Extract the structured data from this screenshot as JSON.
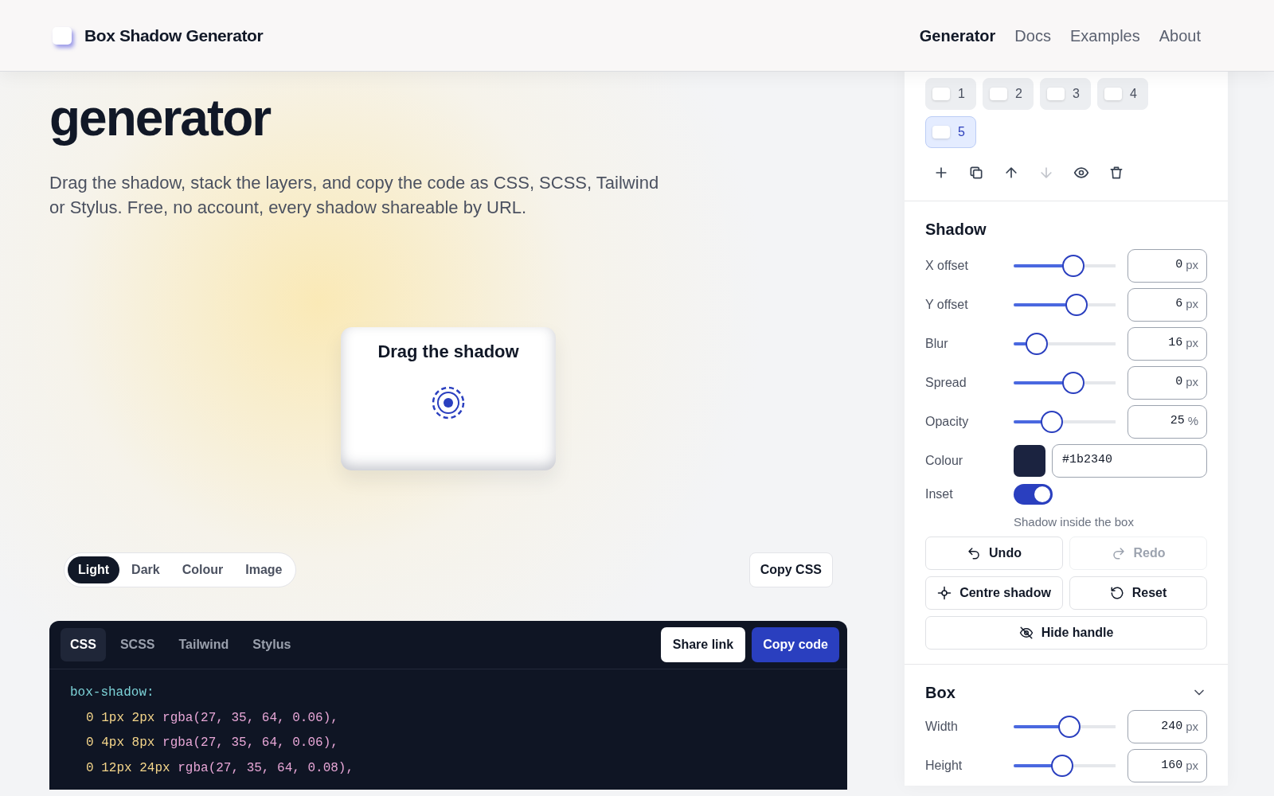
{
  "header": {
    "brand": "Box Shadow Generator",
    "nav": [
      {
        "label": "Generator",
        "selected": true
      },
      {
        "label": "Docs",
        "selected": false
      },
      {
        "label": "Examples",
        "selected": false
      },
      {
        "label": "About",
        "selected": false
      }
    ]
  },
  "hero": {
    "title": "generator",
    "description": "Drag the shadow, stack the layers, and copy the code as CSS, SCSS, Tailwind or Stylus. Free, no account, every shadow shareable by URL."
  },
  "preview": {
    "card_label": "Drag the shadow",
    "backgrounds": [
      {
        "label": "Light",
        "selected": true
      },
      {
        "label": "Dark",
        "selected": false
      },
      {
        "label": "Colour",
        "selected": false
      },
      {
        "label": "Image",
        "selected": false
      }
    ],
    "copy_button": "Copy CSS"
  },
  "code": {
    "tabs": [
      {
        "label": "CSS",
        "selected": true
      },
      {
        "label": "SCSS",
        "selected": false
      },
      {
        "label": "Tailwind",
        "selected": false
      },
      {
        "label": "Stylus",
        "selected": false
      }
    ],
    "share_button": "Share link",
    "copy_button": "Copy code",
    "lines": [
      {
        "indented": false,
        "tokens": [
          {
            "kind": "property",
            "text": "box-shadow:"
          }
        ]
      },
      {
        "indented": true,
        "tokens": [
          {
            "kind": "number",
            "text": "0 1px 2px"
          },
          {
            "kind": "function",
            "text": "rgba(27, 35, 64, 0.06),"
          }
        ]
      },
      {
        "indented": true,
        "tokens": [
          {
            "kind": "number",
            "text": "0 4px 8px"
          },
          {
            "kind": "function",
            "text": "rgba(27, 35, 64, 0.06),"
          }
        ]
      },
      {
        "indented": true,
        "tokens": [
          {
            "kind": "number",
            "text": "0 12px 24px"
          },
          {
            "kind": "function",
            "text": "rgba(27, 35, 64, 0.08),"
          }
        ]
      }
    ]
  },
  "panel": {
    "layers": [
      {
        "label": "1",
        "selected": false
      },
      {
        "label": "2",
        "selected": false
      },
      {
        "label": "3",
        "selected": false
      },
      {
        "label": "4",
        "selected": false
      },
      {
        "label": "5",
        "selected": true
      }
    ],
    "layer_actions": [
      {
        "kind": "add",
        "disabled": false
      },
      {
        "kind": "duplicate",
        "disabled": false
      },
      {
        "kind": "up",
        "disabled": false
      },
      {
        "kind": "down",
        "disabled": true
      },
      {
        "kind": "visibility",
        "disabled": false
      },
      {
        "kind": "delete",
        "disabled": false
      }
    ],
    "shadow": {
      "title": "Shadow",
      "sliders": [
        {
          "label": "X offset",
          "level": 0.49,
          "value": "0",
          "unit": "px"
        },
        {
          "label": "Y offset",
          "level": 0.52,
          "value": "6",
          "unit": "px"
        },
        {
          "label": "Blur",
          "level": 0.13,
          "value": "16",
          "unit": "px"
        },
        {
          "label": "Spread",
          "level": 0.49,
          "value": "0",
          "unit": "px"
        },
        {
          "label": "Opacity",
          "level": 0.28,
          "value": "25",
          "unit": "%"
        }
      ],
      "colour": {
        "label": "Colour",
        "color": "#1b2340",
        "hex": "#1b2340"
      },
      "inset": {
        "label": "Inset",
        "on": true,
        "hint": "Shadow inside the box"
      },
      "buttons": [
        {
          "kind": "undo",
          "label": "Undo",
          "disabled": false
        },
        {
          "kind": "redo",
          "label": "Redo",
          "disabled": true
        },
        {
          "kind": "centre",
          "label": "Centre shadow",
          "disabled": false
        },
        {
          "kind": "reset",
          "label": "Reset",
          "disabled": false
        },
        {
          "kind": "hide",
          "label": "Hide handle",
          "disabled": false
        }
      ]
    },
    "box": {
      "title": "Box",
      "expanded": true,
      "sliders": [
        {
          "label": "Width",
          "level": 0.45,
          "value": "240",
          "unit": "px"
        },
        {
          "label": "Height",
          "level": 0.38,
          "value": "160",
          "unit": "px"
        }
      ]
    }
  }
}
